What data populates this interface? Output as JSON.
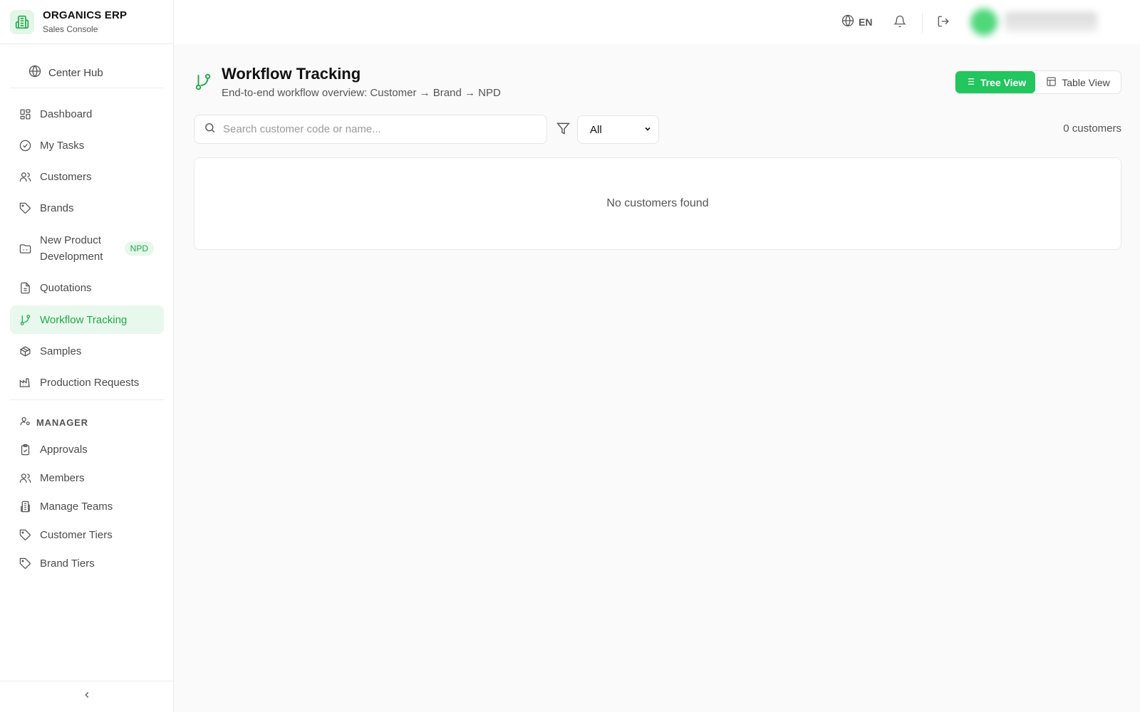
{
  "app": {
    "name": "ORGANICS ERP",
    "subtitle": "Sales Console"
  },
  "sidebar": {
    "hub": "Center Hub",
    "items": [
      {
        "label": "Dashboard"
      },
      {
        "label": "My Tasks"
      },
      {
        "label": "Customers"
      },
      {
        "label": "Brands"
      },
      {
        "label": "New Product Development",
        "badge": "NPD"
      },
      {
        "label": "Quotations"
      },
      {
        "label": "Workflow Tracking",
        "active": true
      },
      {
        "label": "Samples"
      },
      {
        "label": "Production Requests"
      }
    ],
    "manager_section": "MANAGER",
    "manager_items": [
      {
        "label": "Approvals"
      },
      {
        "label": "Members"
      },
      {
        "label": "Manage Teams"
      },
      {
        "label": "Customer Tiers"
      },
      {
        "label": "Brand Tiers"
      }
    ]
  },
  "topbar": {
    "language": "EN"
  },
  "page": {
    "title": "Workflow Tracking",
    "subtitle": "End-to-end workflow overview: Customer → Brand → NPD"
  },
  "view_toggle": {
    "tree": "Tree View",
    "table": "Table View",
    "active": "tree"
  },
  "search": {
    "placeholder": "Search customer code or name...",
    "value": ""
  },
  "filter": {
    "selected": "All"
  },
  "results": {
    "count_text": "0 customers",
    "empty_text": "No customers found"
  },
  "colors": {
    "accent": "#22c55e",
    "accent_text": "#22a84a",
    "accent_bg": "#e8f8ed"
  },
  "icons": {
    "brand": "building-icon",
    "hub": "globe-icon",
    "dashboard": "grid-icon",
    "tasks": "check-circle-icon",
    "customers": "users-icon",
    "brands": "tag-icon",
    "npd": "folder-icon",
    "quotations": "file-text-icon",
    "workflow": "git-branch-icon",
    "samples": "package-icon",
    "production": "factory-icon",
    "manager": "user-cog-icon",
    "approvals": "clipboard-check-icon",
    "members": "users-icon",
    "teams": "building-icon",
    "customer_tiers": "tag-icon",
    "brand_tiers": "tag-icon",
    "collapse": "chevron-left-icon",
    "language": "globe-icon",
    "bell": "bell-icon",
    "logout": "logout-icon",
    "search": "search-icon",
    "filter": "filter-icon",
    "tree": "list-icon",
    "table": "table-icon"
  }
}
